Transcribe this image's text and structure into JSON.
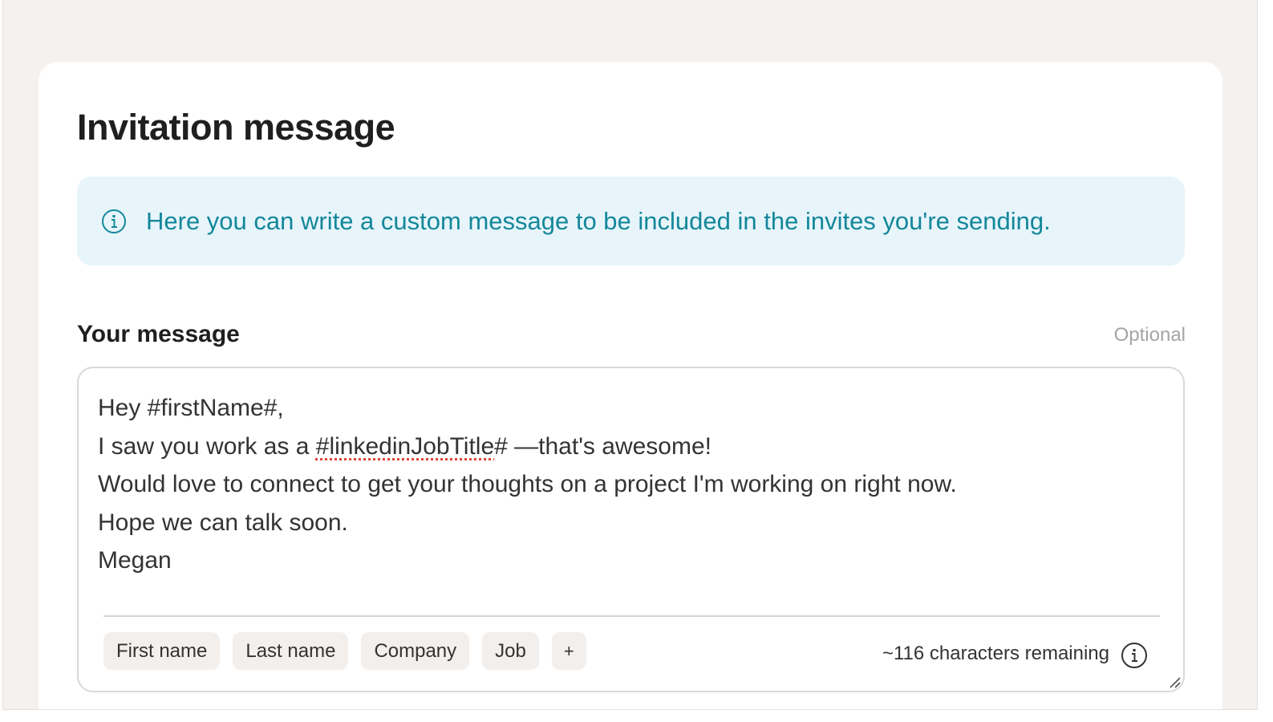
{
  "page": {
    "title": "Invitation message"
  },
  "info_banner": {
    "icon": "info-icon",
    "text": "Here you can write a custom message to be included in the invites you're sending.",
    "color": "#14879b",
    "background": "#e7f5fa"
  },
  "message_field": {
    "label": "Your message",
    "optional_label": "Optional",
    "lines": [
      "Hey #firstName#,",
      "I saw you work as a ",
      "#linkedinJobTitle",
      "# —that's awesome!",
      "Would love to connect to get your thoughts on a project I'm working on right now.",
      "Hope we can talk soon.",
      "Megan"
    ],
    "variable_chips": [
      "First name",
      "Last name",
      "Company",
      "Job",
      "+"
    ],
    "characters_remaining": "~116 characters remaining",
    "remaining_icon": "info-icon",
    "resize_icon": "resize-handle-icon"
  }
}
